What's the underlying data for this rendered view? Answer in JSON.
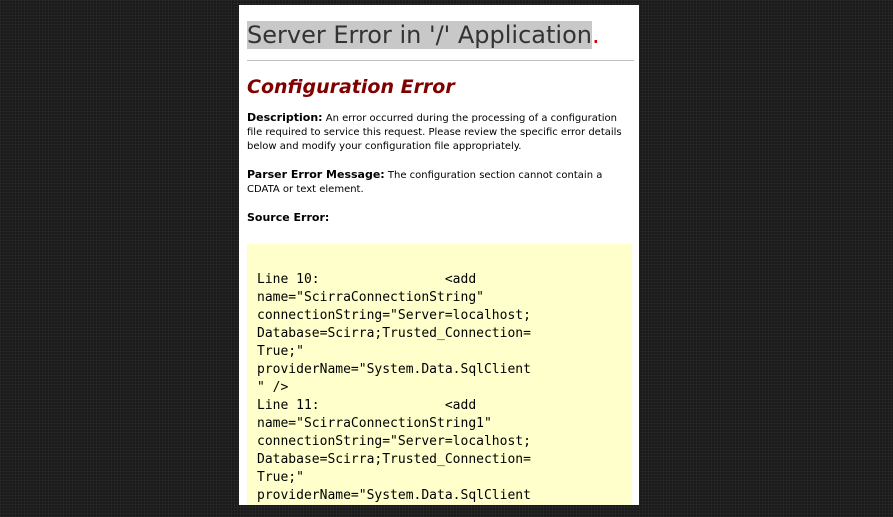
{
  "page": {
    "title_main": "Server Error in '/' Application",
    "title_dot": ".",
    "subtitle": "Configuration Error",
    "description": {
      "label": "Description:",
      "text": "An error occurred during the processing of a configuration file required to service this request. Please review the specific error details below and modify your configuration file appropriately."
    },
    "parser_error": {
      "label": "Parser Error Message:",
      "text": "The configuration section cannot contain a CDATA or text element."
    },
    "source_error": {
      "label": "Source Error:"
    },
    "source_lines": [
      "Line 10:                <add",
      "name=\"ScirraConnectionString\"",
      "connectionString=\"Server=localhost;",
      "Database=Scirra;Trusted_Connection=",
      "True;\"",
      "providerName=\"System.Data.SqlClient",
      "\" />",
      "Line 11:                <add",
      "name=\"ScirraConnectionString1\"",
      "connectionString=\"Server=localhost;",
      "Database=Scirra;Trusted_Connection=",
      "True;\"",
      "providerName=\"System.Data.SqlClient"
    ]
  }
}
